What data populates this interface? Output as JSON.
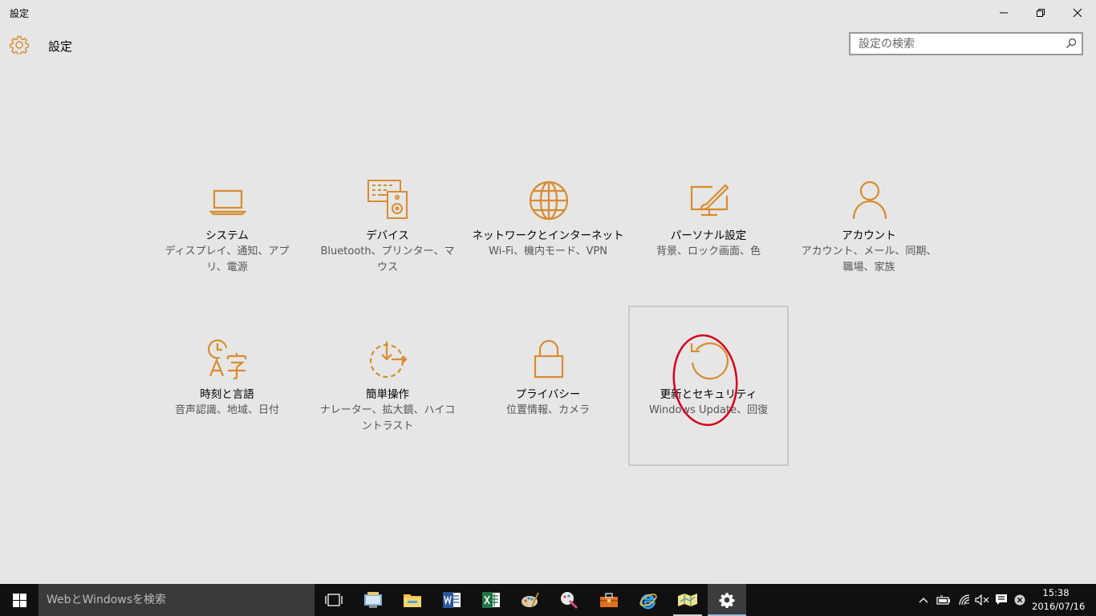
{
  "window": {
    "title": "設定"
  },
  "header": {
    "title": "設定",
    "search_placeholder": "設定の検索"
  },
  "accent_color": "#d88c2e",
  "tiles": [
    {
      "title": "システム",
      "desc": "ディスプレイ、通知、アプリ、電源",
      "icon": "laptop-icon"
    },
    {
      "title": "デバイス",
      "desc": "Bluetooth、プリンター、マウス",
      "icon": "devices-icon"
    },
    {
      "title": "ネットワークとインターネット",
      "desc": "Wi-Fi、機内モード、VPN",
      "icon": "globe-icon"
    },
    {
      "title": "パーソナル設定",
      "desc": "背景、ロック画面、色",
      "icon": "personalization-icon"
    },
    {
      "title": "アカウント",
      "desc": "アカウント、メール、同期、職場、家族",
      "icon": "person-icon"
    },
    {
      "title": "時刻と言語",
      "desc": "音声認識、地域、日付",
      "icon": "time-language-icon"
    },
    {
      "title": "簡単操作",
      "desc": "ナレーター、拡大鏡、ハイコントラスト",
      "icon": "ease-of-access-icon"
    },
    {
      "title": "プライバシー",
      "desc": "位置情報、カメラ",
      "icon": "lock-icon"
    },
    {
      "title": "更新とセキュリティ",
      "desc": "Windows Update、回復",
      "icon": "update-icon",
      "selected": true
    }
  ],
  "taskbar": {
    "search_placeholder": "WebとWindowsを検索",
    "clock_time": "15:38",
    "clock_date": "2016/07/16"
  }
}
